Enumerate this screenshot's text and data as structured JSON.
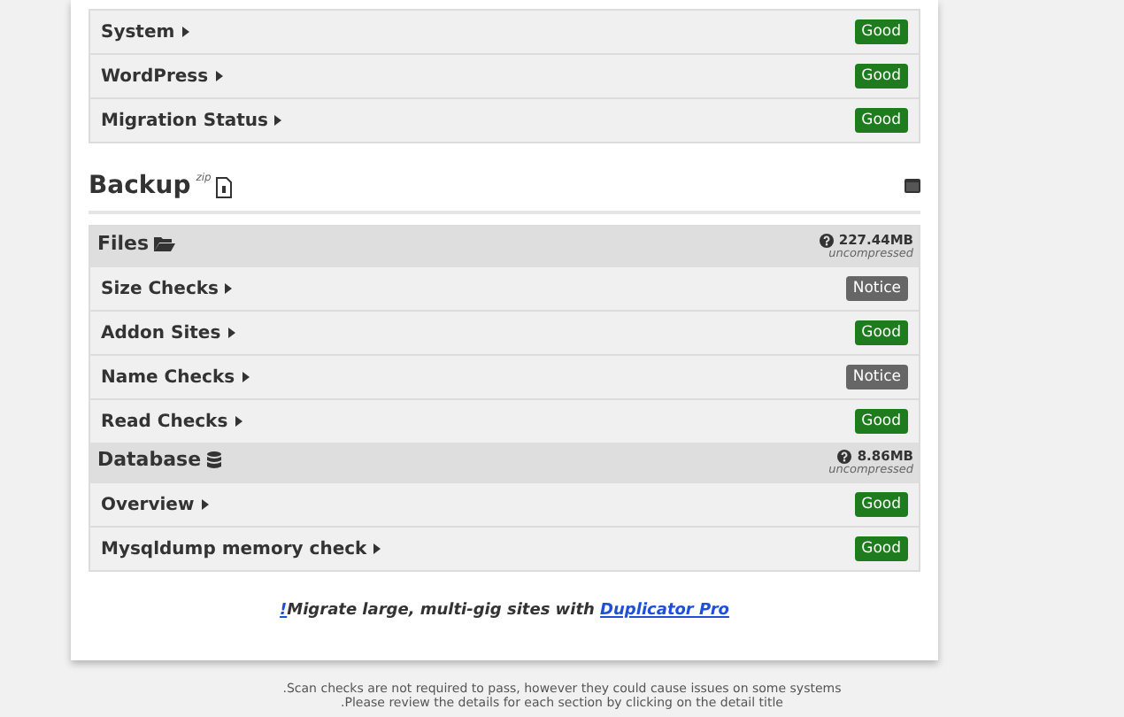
{
  "server_checks": [
    {
      "label": "System",
      "status": "Good",
      "kind": "good"
    },
    {
      "label": "WordPress",
      "status": "Good",
      "kind": "good"
    },
    {
      "label": "Migration Status",
      "status": "Good",
      "kind": "good"
    }
  ],
  "backup": {
    "title": "Backup",
    "zip_label": "zip",
    "sections": [
      {
        "kind": "files",
        "title": "Files",
        "size": "227.44MB",
        "size_note": "uncompressed",
        "checks": [
          {
            "label": "Size Checks",
            "status": "Notice",
            "kind": "notice"
          },
          {
            "label": "Addon Sites",
            "status": "Good",
            "kind": "good"
          },
          {
            "label": "Name Checks",
            "status": "Notice",
            "kind": "notice"
          },
          {
            "label": "Read Checks",
            "status": "Good",
            "kind": "good"
          }
        ]
      },
      {
        "kind": "database",
        "title": "Database",
        "size": "8.86MB",
        "size_note": "uncompressed",
        "checks": [
          {
            "label": "Overview",
            "status": "Good",
            "kind": "good"
          },
          {
            "label": "Mysqldump memory check",
            "status": "Good",
            "kind": "good"
          }
        ]
      }
    ]
  },
  "promo": {
    "mark": "!",
    "text": "Migrate large, multi-gig sites with ",
    "link": "Duplicator Pro"
  },
  "footer": [
    ".Scan checks are not required to pass, however they could cause issues on some systems",
    ".Please review the details for each section by clicking on the detail title"
  ]
}
